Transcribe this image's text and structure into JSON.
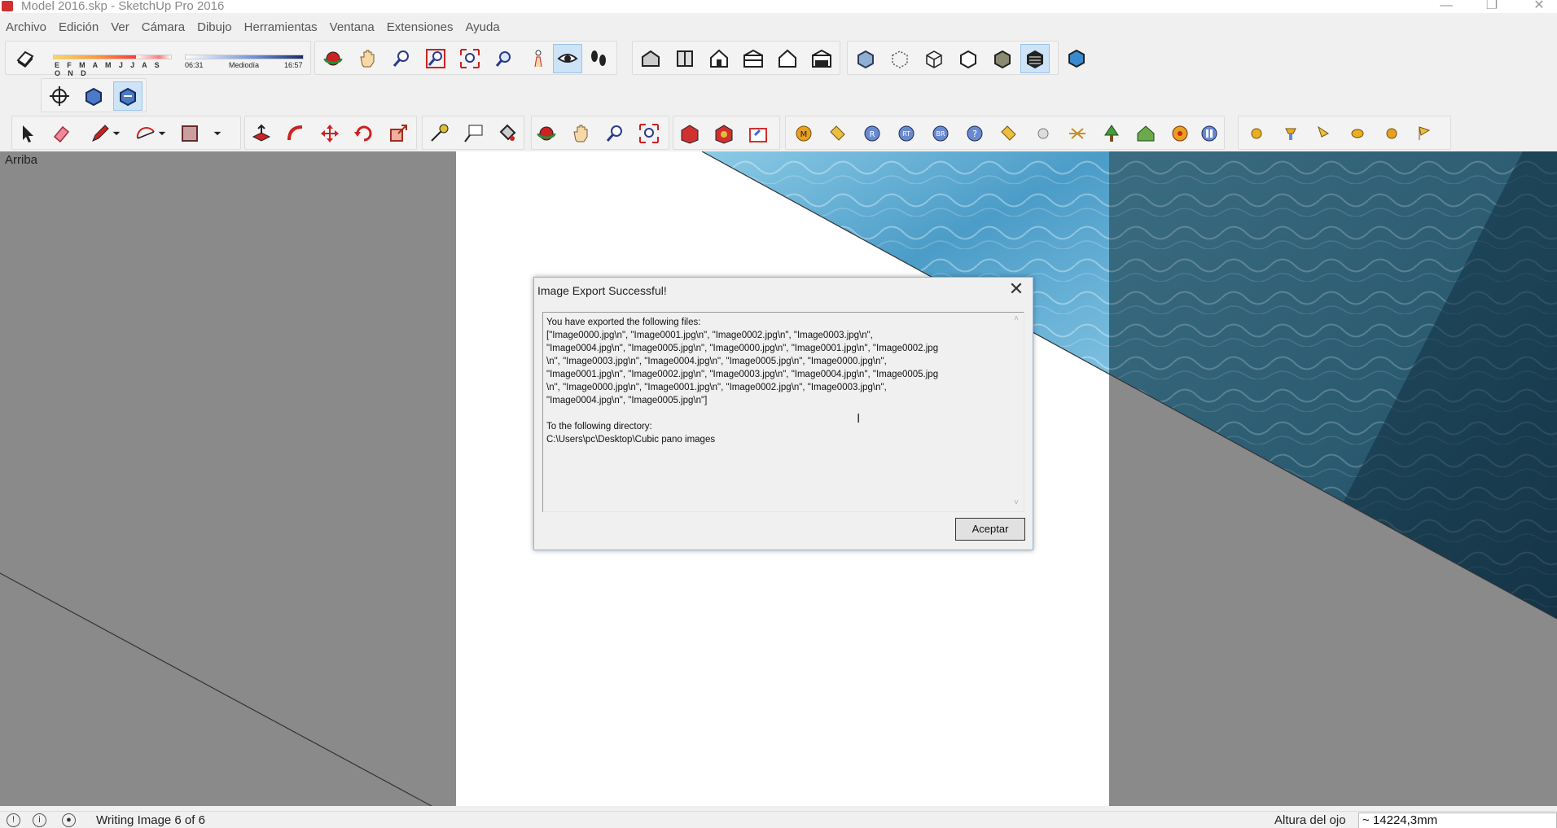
{
  "window": {
    "title": "Model 2016.skp - SketchUp Pro 2016",
    "controls": {
      "minimize": "—",
      "restore": "❐",
      "close": "✕"
    }
  },
  "menu": [
    "Archivo",
    "Edición",
    "Ver",
    "Cámara",
    "Dibujo",
    "Herramientas",
    "Ventana",
    "Extensiones",
    "Ayuda"
  ],
  "shadows": {
    "months": "E F M A M J J A S O N D",
    "time_start": "06:31",
    "time_mid": "Mediodía",
    "time_end": "16:57"
  },
  "viewport": {
    "view_label": "Arriba"
  },
  "dialog": {
    "title": "Image Export Successful!",
    "close": "✕",
    "message": "You have exported the following files:\n[\"Image0000.jpg\\n\", \"Image0001.jpg\\n\", \"Image0002.jpg\\n\", \"Image0003.jpg\\n\",\n\"Image0004.jpg\\n\", \"Image0005.jpg\\n\", \"Image0000.jpg\\n\", \"Image0001.jpg\\n\", \"Image0002.jpg\n\\n\", \"Image0003.jpg\\n\", \"Image0004.jpg\\n\", \"Image0005.jpg\\n\", \"Image0000.jpg\\n\",\n\"Image0001.jpg\\n\", \"Image0002.jpg\\n\", \"Image0003.jpg\\n\", \"Image0004.jpg\\n\", \"Image0005.jpg\n\\n\", \"Image0000.jpg\\n\", \"Image0001.jpg\\n\", \"Image0002.jpg\\n\", \"Image0003.jpg\\n\",\n\"Image0004.jpg\\n\", \"Image0005.jpg\\n\"]\n\nTo the following directory:\nC:\\Users\\pc\\Desktop\\Cubic pano images",
    "ok_label": "Aceptar"
  },
  "status": {
    "message": "Writing Image 6 of 6",
    "eye_height_label": "Altura del ojo",
    "eye_height_value": "~ 14224,3mm"
  },
  "colors": {
    "water_light": "#5ea9cf",
    "water_dark": "#1f4f66",
    "accent_active": "#cde3f7"
  }
}
